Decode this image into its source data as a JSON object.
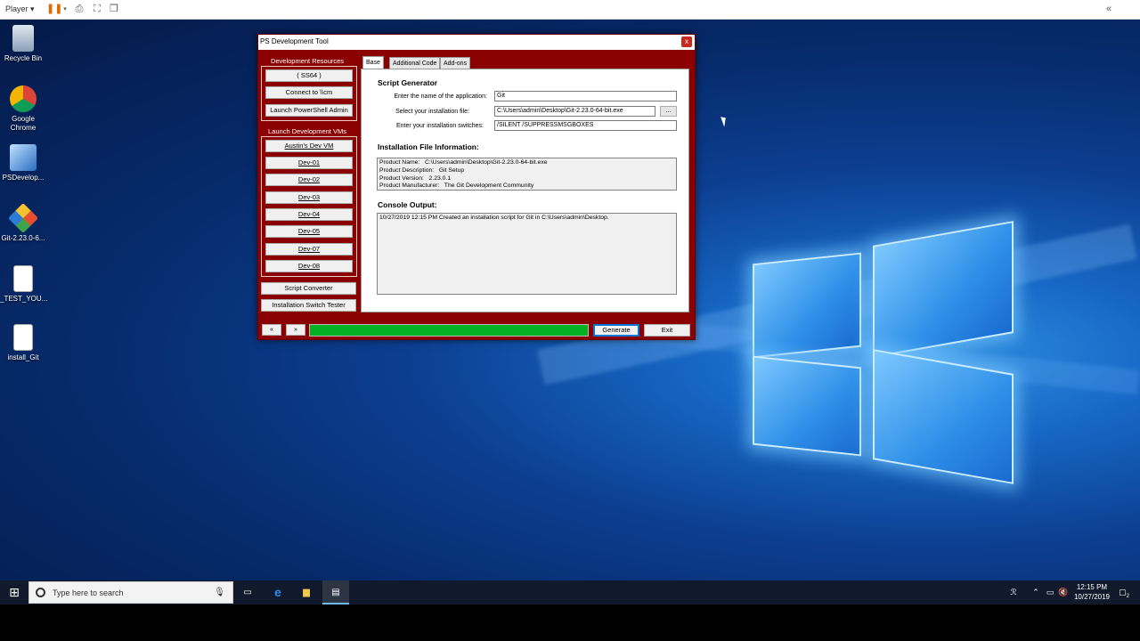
{
  "player": {
    "menu_label": "Player ▾",
    "collapse_icon": "«"
  },
  "desktop_icons": [
    {
      "label": "Recycle Bin",
      "icon": "recycle-bin-icon"
    },
    {
      "label": "Google Chrome",
      "icon": "chrome-icon"
    },
    {
      "label": "PSDevelop...",
      "icon": "ps-tool-icon"
    },
    {
      "label": "Git-2.23.0-6...",
      "icon": "git-installer-icon"
    },
    {
      "label": "_TEST_YOU...",
      "icon": "script-file-icon"
    },
    {
      "label": "install_Git",
      "icon": "script-file-icon"
    }
  ],
  "window": {
    "title": "PS Development Tool",
    "close_label": "x"
  },
  "dev_resources": {
    "title": "Development Resources",
    "buttons": [
      "( SS64 )",
      "Connect to \\\\cm",
      "Launch PowerShell Admin"
    ]
  },
  "dev_vms": {
    "title": "Launch Development VMs",
    "buttons": [
      "Austin's Dev VM",
      "Dev-01",
      "Dev-02",
      "Dev-03",
      "Dev-04",
      "Dev-05",
      "Dev-07",
      "Dev-08"
    ]
  },
  "tools": {
    "script_converter": "Script Converter",
    "switch_tester": "Installation Switch Tester"
  },
  "tabs": [
    "Base",
    "Additional Code",
    "Add-ons"
  ],
  "script_generator": {
    "heading": "Script Generator",
    "app_name_label": "Enter the name of the application:",
    "app_name_value": "Git",
    "file_label": "Select your installation file:",
    "file_value": "C:\\Users\\admin\\Desktop\\Git-2.23.0-64-bit.exe",
    "browse_label": "...",
    "switches_label": "Enter your installation switches:",
    "switches_value": "/SILENT /SUPPRESSMSGBOXES"
  },
  "file_info": {
    "heading": "Installation File Information:",
    "text": "Product Name:   C:\\Users\\admin\\Desktop\\Git-2.23.0-64-bit.exe\nProduct Description:   Git Setup\nProduct Version:   2.23.0.1\nProduct Manufacturer:   The Git Development Community"
  },
  "console": {
    "heading": "Console Output:",
    "text": "10/27/2019 12:15 PM Created an installation script for Git in C:\\Users\\admin\\Desktop."
  },
  "bottom": {
    "prev_label": "«",
    "next_label": "»",
    "progress": 1.0,
    "generate_label": "Generate",
    "exit_label": "Exit"
  },
  "taskbar": {
    "search_placeholder": "Type here to search",
    "time": "12:15 PM",
    "date": "10/27/2019",
    "notification_count": "2"
  },
  "colors": {
    "window_frame": "#8b0000",
    "progress_fill": "#06b025",
    "taskbar": "#101a2c"
  }
}
